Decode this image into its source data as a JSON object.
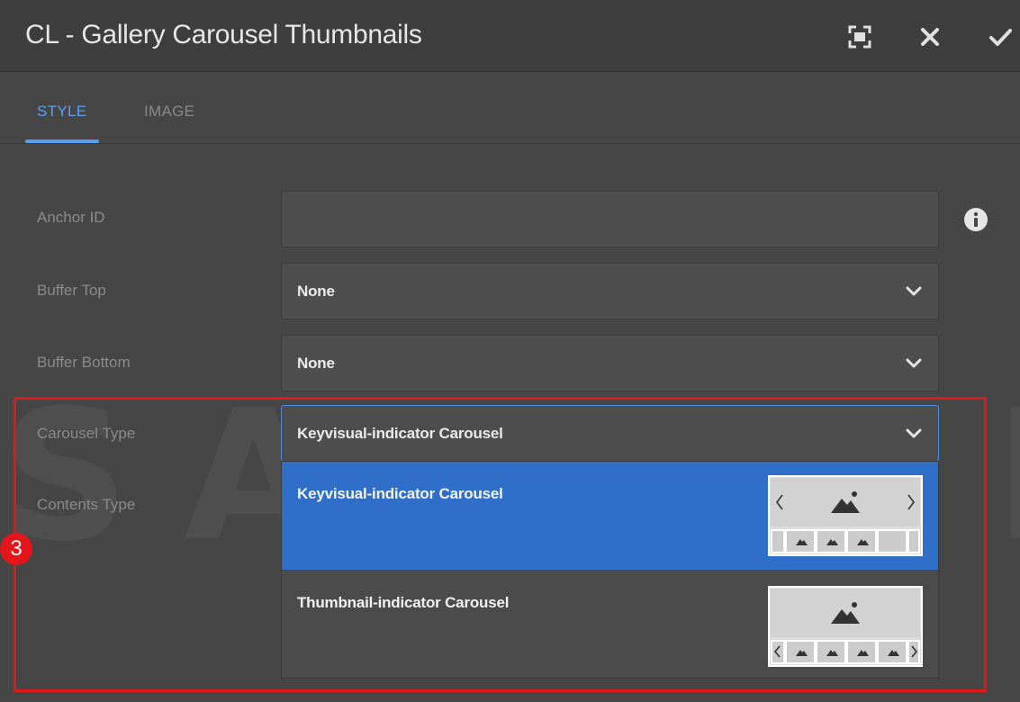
{
  "dialog": {
    "title": "CL - Gallery Carousel Thumbnails",
    "icons": {
      "fullscreen": "fullscreen-icon",
      "close": "close-icon",
      "confirm": "check-icon"
    }
  },
  "tabs": [
    {
      "label": "STYLE",
      "active": true
    },
    {
      "label": "IMAGE",
      "active": false
    }
  ],
  "form": {
    "anchor_id": {
      "label": "Anchor ID",
      "value": "",
      "info_icon": "info-icon"
    },
    "buffer_top": {
      "label": "Buffer Top",
      "value": "None"
    },
    "buffer_bottom": {
      "label": "Buffer Bottom",
      "value": "None"
    },
    "carousel_type": {
      "label": "Carousel Type",
      "value": "Keyvisual-indicator Carousel",
      "options": [
        {
          "label": "Keyvisual-indicator Carousel",
          "selected": true
        },
        {
          "label": "Thumbnail-indicator Carousel",
          "selected": false
        }
      ]
    },
    "contents_type": {
      "label": "Contents Type"
    }
  },
  "watermark": "SAMSUNG",
  "annotation": {
    "step": "3",
    "color": "#e3161c"
  },
  "colors": {
    "accent": "#5aa0f0",
    "selected_option": "#2f6fc9",
    "background": "#464646"
  }
}
